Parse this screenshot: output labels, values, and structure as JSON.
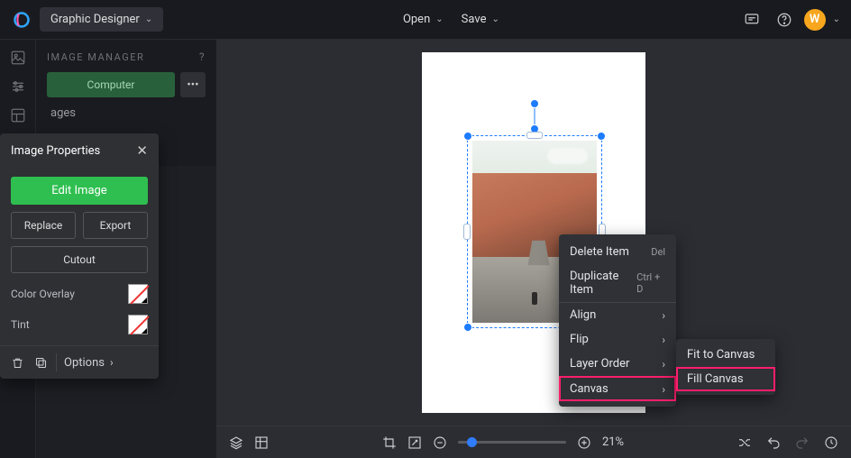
{
  "topbar": {
    "mode_label": "Graphic Designer",
    "open_label": "Open",
    "save_label": "Save",
    "avatar_letter": "W"
  },
  "image_manager": {
    "title": "IMAGE MANAGER",
    "computer_btn": "Computer",
    "link_label": "ages"
  },
  "properties": {
    "title": "Image Properties",
    "edit_btn": "Edit Image",
    "replace_btn": "Replace",
    "export_btn": "Export",
    "cutout_btn": "Cutout",
    "color_overlay_label": "Color Overlay",
    "tint_label": "Tint",
    "options_label": "Options"
  },
  "context_menu": {
    "delete": "Delete Item",
    "delete_short": "Del",
    "duplicate": "Duplicate Item",
    "duplicate_short": "Ctrl + D",
    "align": "Align",
    "flip": "Flip",
    "layer_order": "Layer Order",
    "canvas": "Canvas",
    "submenu": {
      "fit": "Fit to Canvas",
      "fill": "Fill Canvas"
    }
  },
  "bottombar": {
    "zoom_value": "21%"
  }
}
